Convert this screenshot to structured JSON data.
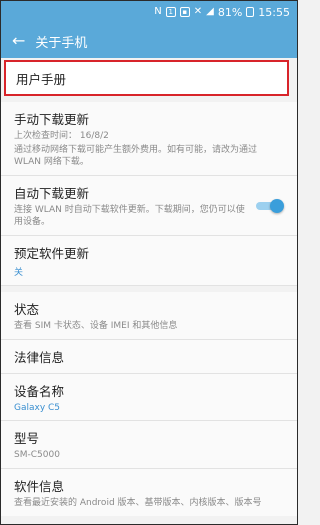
{
  "status_bar": {
    "icons": [
      "n-icon",
      "notification-icon",
      "image-icon",
      "mute-icon",
      "signal-icon"
    ],
    "battery": "81%",
    "time": "15:55"
  },
  "app_bar": {
    "title": "关于手机"
  },
  "user_manual": {
    "label": "用户手册"
  },
  "manual_update": {
    "title": "手动下载更新",
    "last_check": "上次检查时间： 16/8/2",
    "desc": "通过移动网络下载可能产生额外费用。如有可能，请改为通过 WLAN 网络下载。"
  },
  "auto_update": {
    "title": "自动下载更新",
    "desc": "连接 WLAN 时自动下载软件更新。下载期间，您仍可以使用设备。",
    "enabled": true
  },
  "scheduled_update": {
    "title": "预定软件更新",
    "value": "关"
  },
  "status": {
    "title": "状态",
    "desc": "查看 SIM 卡状态、设备 IMEI 和其他信息"
  },
  "legal": {
    "title": "法律信息"
  },
  "device_name": {
    "title": "设备名称",
    "value": "Galaxy C5"
  },
  "model": {
    "title": "型号",
    "value": "SM-C5000"
  },
  "software_info": {
    "title": "软件信息",
    "desc": "查看最近安装的 Android 版本、基带版本、内核版本、版本号"
  },
  "colors": {
    "accent": "#5aa9d9",
    "highlight": "#d8242a",
    "link": "#3a8fd0"
  }
}
